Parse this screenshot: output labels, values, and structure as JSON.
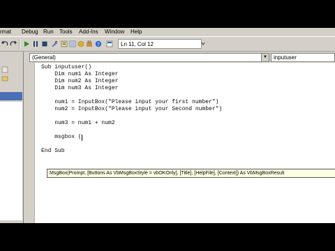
{
  "menu": [
    "rmat",
    "Debug",
    "Run",
    "Tools",
    "Add-Ins",
    "Window",
    "Help"
  ],
  "toolbar": {
    "status": "Ln 11, Col 12",
    "icons": [
      "undo-icon",
      "redo-icon",
      "run-icon",
      "break-icon",
      "reset-icon",
      "design-mode-icon",
      "project-explorer-icon",
      "properties-icon",
      "object-browser-icon",
      "toolbox-icon",
      "help-icon"
    ]
  },
  "code_window": {
    "object_combo": "(General)",
    "procedure_combo": "inputuser",
    "lines": [
      "Sub inputuser()",
      "    Dim num1 As Integer",
      "    Dim num2 As Integer",
      "    Dim num3 As Integer",
      "",
      "    num1 = InputBox(\"Please input your first number\")",
      "    num2 = InputBox(\"Please input your Second number\")",
      "",
      "    num3 = num1 + num2",
      "",
      "    msgbox (",
      "End Sub"
    ],
    "tooltip": "MsgBox(Prompt, [Buttons As VbMsgBoxStyle = vbOKOnly], [Title], [HelpFile], [Context]) As VbMsgBoxResult"
  }
}
